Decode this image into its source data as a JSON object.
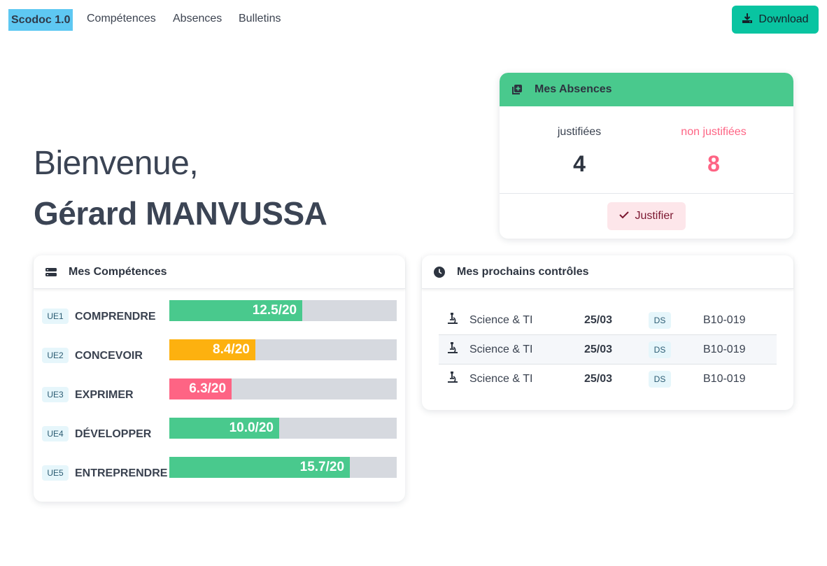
{
  "nav": {
    "brand": "Scodoc 1.0",
    "links": [
      "Compétences",
      "Absences",
      "Bulletins"
    ],
    "download_label": "Download",
    "download_icon": "download-icon"
  },
  "hero": {
    "greeting": "Bienvenue,",
    "name": "Gérard MANVUSSA"
  },
  "absences": {
    "title": "Mes Absences",
    "icon": "absences-icon",
    "justified_label": "justifiées",
    "justified_value": "4",
    "unjustified_label": "non justifiées",
    "unjustified_value": "8",
    "justify_button": "Justifier"
  },
  "competences": {
    "title": "Mes Compétences",
    "icon": "list-icon",
    "items": [
      {
        "ue": "UE1",
        "name": "COMPRENDRE",
        "score": "12.5/20",
        "fraction": 0.585,
        "color": "#49c98d"
      },
      {
        "ue": "UE2",
        "name": "CONCEVOIR",
        "score": "8.4/20",
        "fraction": 0.378,
        "color": "#fdb10f"
      },
      {
        "ue": "UE3",
        "name": "EXPRIMER",
        "score": "6.3/20",
        "fraction": 0.274,
        "color": "#fe6484"
      },
      {
        "ue": "UE4",
        "name": "DÉVELOPPER",
        "score": "10.0/20",
        "fraction": 0.483,
        "color": "#49c98d"
      },
      {
        "ue": "UE5",
        "name": "ENTREPRENDRE",
        "score": "15.7/20",
        "fraction": 0.794,
        "color": "#49c98d"
      }
    ]
  },
  "controles": {
    "title": "Mes prochains contrôles",
    "icon": "clock-icon",
    "rows": [
      {
        "matiere": "Science & TI",
        "date": "25/03",
        "type": "DS",
        "salle": "B10-019"
      },
      {
        "matiere": "Science & TI",
        "date": "25/03",
        "type": "DS",
        "salle": "B10-019"
      },
      {
        "matiere": "Science & TI",
        "date": "25/03",
        "type": "DS",
        "salle": "B10-019"
      }
    ]
  },
  "colors": {
    "brand_bg": "#5ec8f2",
    "download_bg": "#09c4a1",
    "absences_header": "#49c98d",
    "unjustified": "#fe6484",
    "justify_bg": "#fde6ea"
  }
}
